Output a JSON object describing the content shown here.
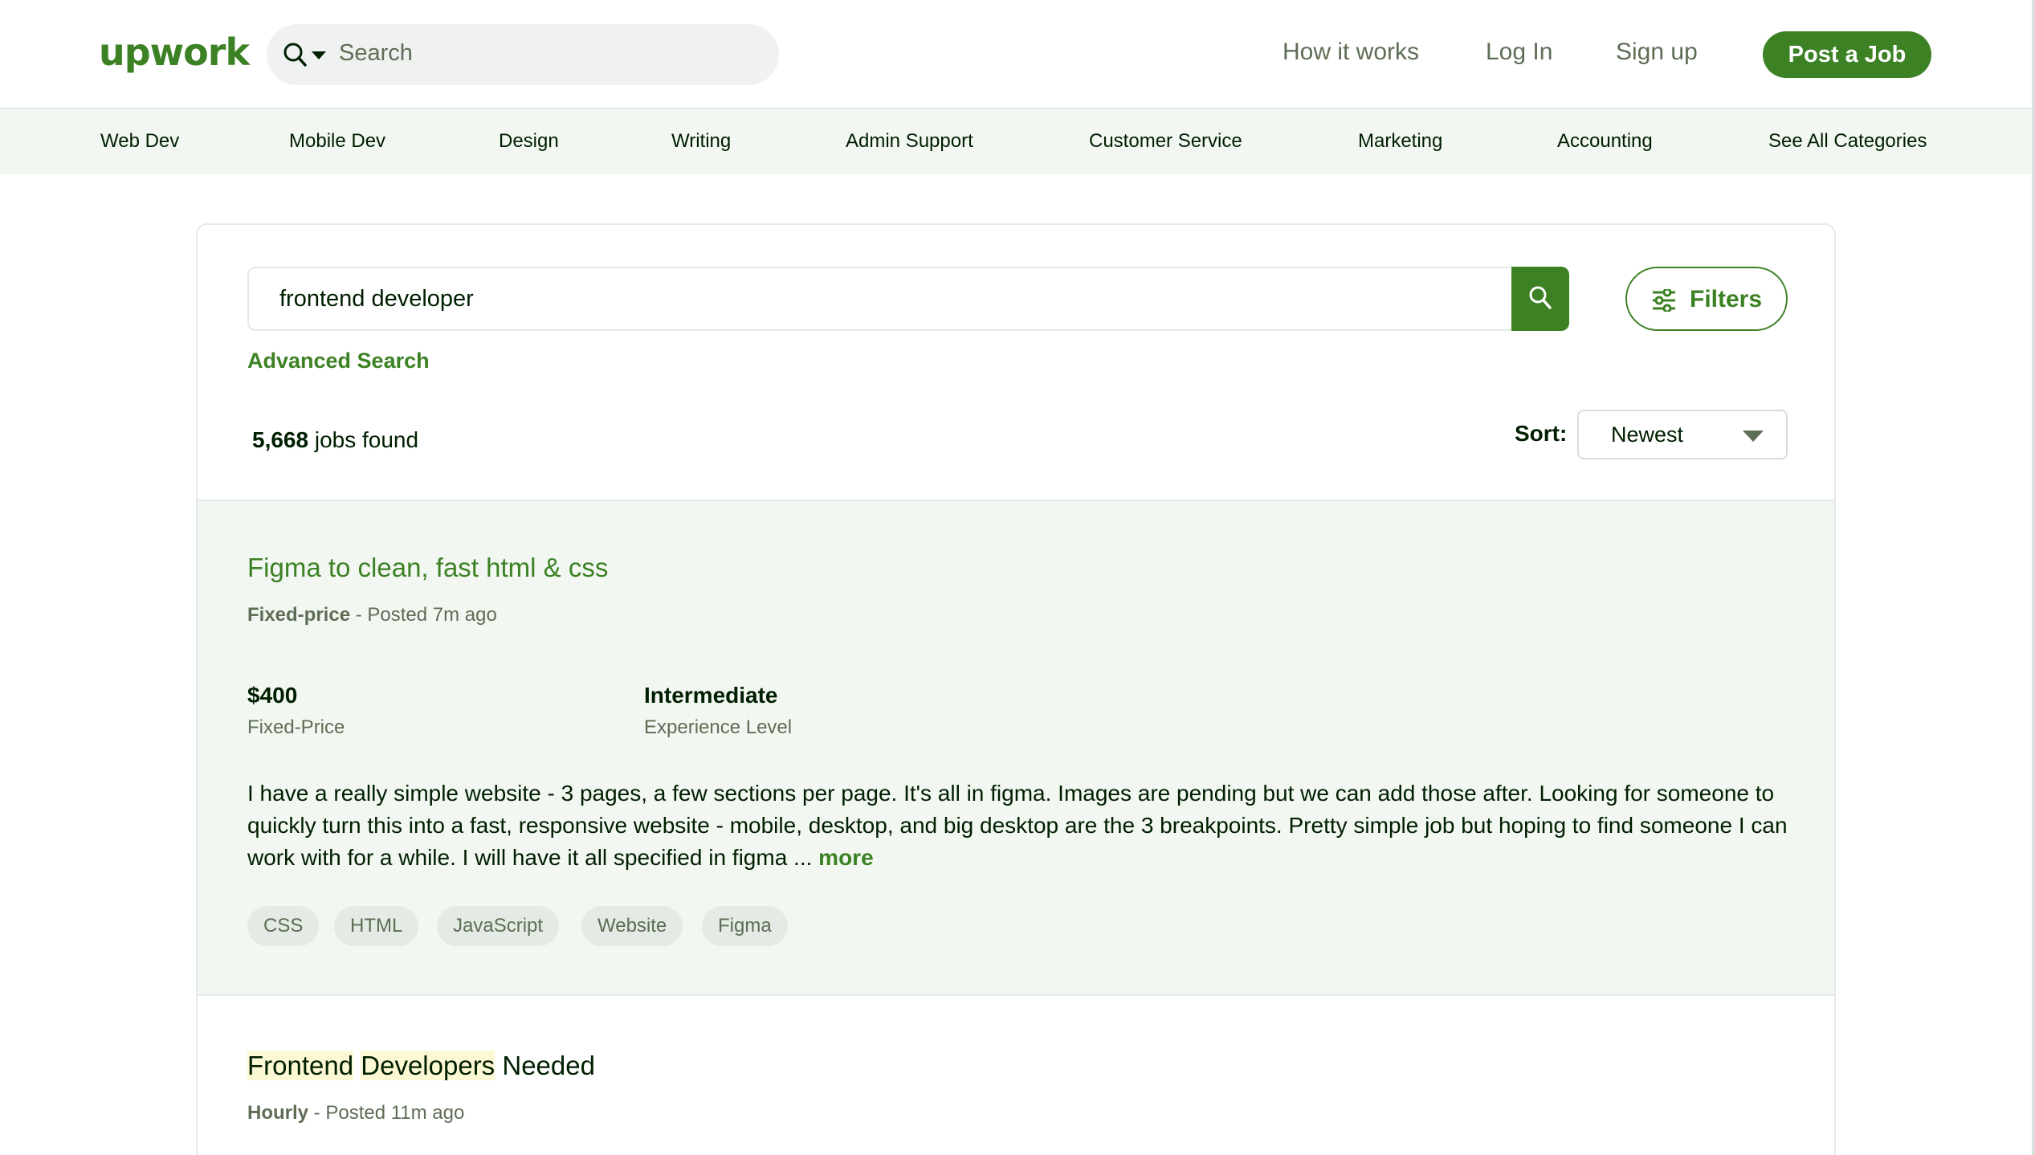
{
  "header": {
    "logo": "upwork",
    "search_placeholder": "Search",
    "links": {
      "how_it_works": "How it works",
      "log_in": "Log In",
      "sign_up": "Sign up"
    },
    "post_job": "Post a Job"
  },
  "categories": [
    "Web Dev",
    "Mobile Dev",
    "Design",
    "Writing",
    "Admin Support",
    "Customer Service",
    "Marketing",
    "Accounting",
    "See All Categories"
  ],
  "search": {
    "query": "frontend developer",
    "filters_label": "Filters",
    "advanced_label": "Advanced Search",
    "count": "5,668",
    "count_suffix": " jobs found",
    "sort_label": "Sort:",
    "sort_value": "Newest"
  },
  "jobs": [
    {
      "title": "Figma to clean, fast html & css",
      "type": "Fixed-price",
      "posted": " - Posted 7m ago",
      "price": "$400",
      "price_label": "Fixed-Price",
      "level": "Intermediate",
      "level_label": "Experience Level",
      "description": "I have a really simple website - 3 pages, a few sections per page. It's all in figma. Images are pending but we can add those after. Looking for someone to quickly turn this into a fast, responsive website - mobile, desktop, and big desktop are the 3 breakpoints. Pretty simple job but hoping to find someone I can work with for a while. I will have it all specified in figma ...",
      "more": "more",
      "tags": [
        "CSS",
        "HTML",
        "JavaScript",
        "Website",
        "Figma"
      ]
    },
    {
      "title_parts": [
        "Frontend",
        "Developers",
        "Needed"
      ],
      "type": "Hourly",
      "posted": " - Posted 11m ago"
    }
  ],
  "colors": {
    "brand_green": "#3c8224",
    "light_green_bg": "#f2f7f2",
    "highlight": "#fcf8d4"
  }
}
